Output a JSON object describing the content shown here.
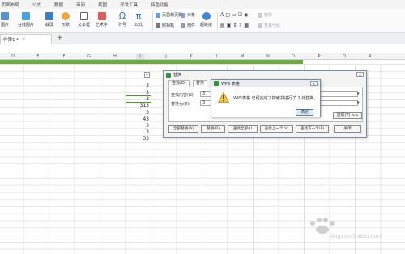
{
  "menu": {
    "items": [
      "页面布局",
      "公式",
      "数据",
      "审阅",
      "视图",
      "开发工具",
      "特色功能"
    ]
  },
  "ribbon": {
    "picture": "图片",
    "online_picture": "在线图片",
    "screenshot": "截屏",
    "shapes": "形状",
    "textbox": "文本框",
    "art_text": "艺术字",
    "symbol": "符号",
    "formula": "公式",
    "header_footer": "页眉和页脚",
    "object": "对象",
    "camera": "照相机",
    "attachment": "附件",
    "hyperlink": "超链接",
    "form_control": "窗体",
    "view_code": "查看代码",
    "symbol_omega": "Ω",
    "formula_pi": "π"
  },
  "tabs": {
    "doc_title": "作簿1 *",
    "add": "+"
  },
  "grid": {
    "columns": [
      "D",
      "E",
      "F",
      "G",
      "H",
      "I",
      "J",
      "K",
      "L",
      "M",
      "N",
      "O",
      "P",
      "Q",
      "R"
    ],
    "values": [
      "3",
      "3",
      "3",
      "313",
      "3",
      "43",
      "3",
      "3",
      "33"
    ]
  },
  "replace_dialog": {
    "title": "替换",
    "tab_find": "查找(D)",
    "tab_replace": "替换",
    "find_label": "查找内容(N):",
    "find_value": "3",
    "replace_label": "替换为(E):",
    "replace_value": "3",
    "options_button": "选项(T) >>",
    "buttons": [
      "全部替换(A)",
      "替换(R)",
      "查找全部(I)",
      "查找上一个(V)",
      "查找下一个(F)",
      "关闭"
    ]
  },
  "message_box": {
    "title": "WPS 表格",
    "text": "WPS表格 已经完成了搜索并进行了 2 处替换。",
    "ok": "确定"
  },
  "watermark": {
    "text": "jingyan.baidu.com"
  }
}
